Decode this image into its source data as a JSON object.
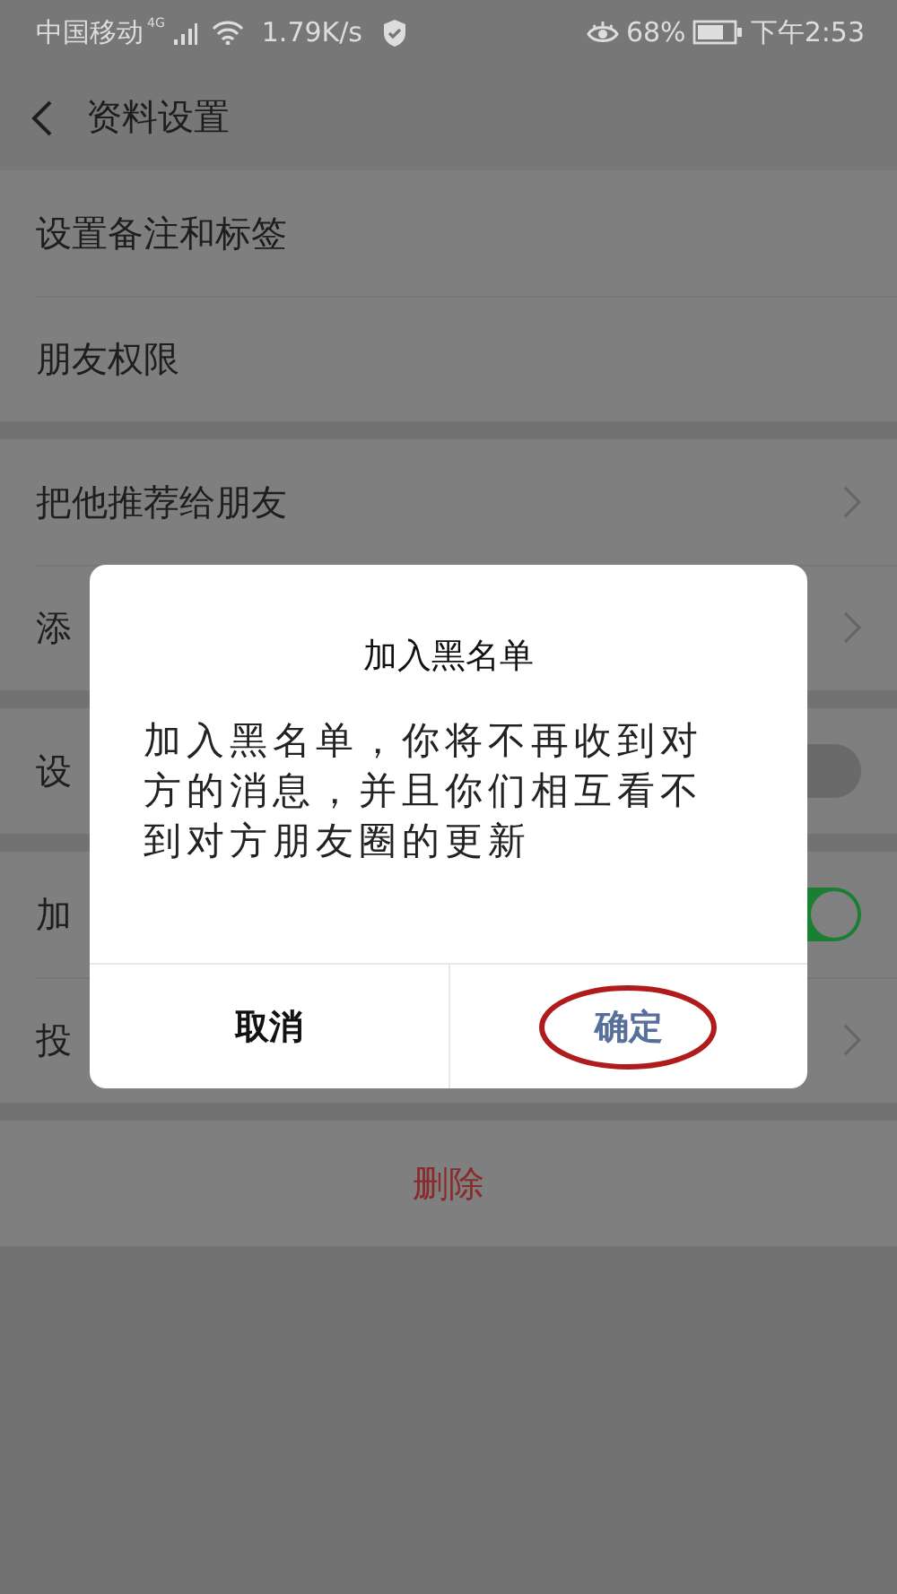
{
  "status_bar": {
    "carrier": "中国移动",
    "network": "4G",
    "speed": "1.79K/s",
    "battery": "68%",
    "time": "下午2:53"
  },
  "header": {
    "title": "资料设置"
  },
  "groups": [
    {
      "rows": [
        {
          "label": "设置备注和标签",
          "kind": "plain"
        },
        {
          "label": "朋友权限",
          "kind": "plain"
        }
      ]
    },
    {
      "rows": [
        {
          "label": "把他推荐给朋友",
          "kind": "chevron"
        },
        {
          "label": "添",
          "kind": "chevron"
        }
      ]
    },
    {
      "rows": [
        {
          "label": "设",
          "kind": "switch",
          "on": false
        }
      ]
    },
    {
      "rows": [
        {
          "label": "加",
          "kind": "switch",
          "on": true
        },
        {
          "label": "投",
          "kind": "chevron"
        }
      ]
    }
  ],
  "delete_button": {
    "label": "删除"
  },
  "dialog": {
    "title": "加入黑名单",
    "message": "加入黑名单，你将不再收到对方的消息，并且你们相互看不到对方朋友圈的更新",
    "buttons": [
      {
        "label": "取消",
        "kind": "cancel",
        "circled": false
      },
      {
        "label": "确定",
        "kind": "confirm",
        "circled": true
      }
    ]
  }
}
